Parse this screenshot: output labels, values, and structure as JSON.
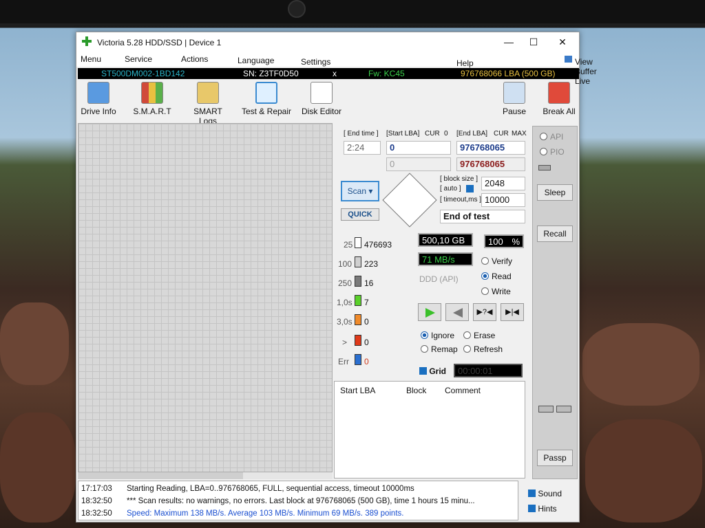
{
  "window": {
    "title": "Victoria 5.28 HDD/SSD | Device 1"
  },
  "menu": {
    "items": [
      "Menu",
      "Service",
      "Actions",
      "Language",
      "Settings",
      "Help"
    ],
    "view_buffer_live": "View Buffer Live"
  },
  "device": {
    "model": "ST500DM002-1BD142",
    "sn": "SN: Z3TF0D50",
    "close": "x",
    "fw": "Fw: KC45",
    "lba": "976768066 LBA (500 GB)"
  },
  "toolbar": {
    "drive_info": "Drive Info",
    "smart": "S.M.A.R.T",
    "smart_logs": "SMART Logs",
    "test_repair": "Test & Repair",
    "disk_editor": "Disk Editor",
    "pause": "Pause",
    "break_all": "Break All"
  },
  "controls": {
    "end_time_label": "[ End time ]",
    "end_time": "2:24",
    "start_lba_label": "[Start LBA]",
    "cur": "CUR",
    "zero": "0",
    "end_lba_label": "[End LBA]",
    "max": "MAX",
    "start_lba": "0",
    "end_lba": "976768065",
    "cur_lba": "0",
    "cur_end_lba": "976768065",
    "block_size_label": "[ block size ]",
    "auto_label": "[ auto ]",
    "block_size": "2048",
    "timeout_label": "[ timeout,ms ]",
    "timeout": "10000",
    "scan": "Scan",
    "quick": "QUICK",
    "end_of_test": "End of test"
  },
  "stats": [
    {
      "label": "25",
      "value": "476693",
      "color": "#ffffff"
    },
    {
      "label": "100",
      "value": "223",
      "color": "#cfcfcf"
    },
    {
      "label": "250",
      "value": "16",
      "color": "#7a7a7a"
    },
    {
      "label": "1,0s",
      "value": "7",
      "color": "#5ad02a"
    },
    {
      "label": "3,0s",
      "value": "0",
      "color": "#f08a2a"
    },
    {
      "label": ">",
      "value": "0",
      "color": "#e03a1a"
    },
    {
      "label": "Err",
      "value": "0",
      "color": "#2a6fd0"
    }
  ],
  "progress": {
    "size": "500,10 GB",
    "percent": "100",
    "percent_sign": "%",
    "speed": "71 MB/s"
  },
  "mode": {
    "verify": "Verify",
    "read": "Read",
    "write": "Write",
    "ddd": "DDD (API)"
  },
  "actions": {
    "ignore": "Ignore",
    "erase": "Erase",
    "remap": "Remap",
    "refresh": "Refresh",
    "grid": "Grid",
    "timer": "00:00:01"
  },
  "table": {
    "col1": "Start LBA",
    "col2": "Block",
    "col3": "Comment"
  },
  "side": {
    "api": "API",
    "pio": "PIO",
    "sleep": "Sleep",
    "recall": "Recall",
    "passp": "Passp"
  },
  "log": [
    {
      "time": "17:17:03",
      "msg": "Starting Reading, LBA=0..976768065, FULL, sequential access, timeout 10000ms"
    },
    {
      "time": "18:32:50",
      "msg": "*** Scan results: no warnings, no errors. Last block at 976768065 (500 GB), time 1 hours 15 minu..."
    },
    {
      "time": "18:32:50",
      "msg": "Speed: Maximum 138 MB/s. Average 103 MB/s. Minimum 69 MB/s. 389 points."
    }
  ],
  "options": {
    "sound": "Sound",
    "hints": "Hints"
  }
}
